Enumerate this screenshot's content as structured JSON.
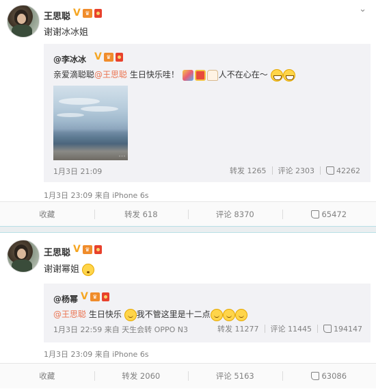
{
  "post1": {
    "author": "王思聪",
    "text": "谢谢冰冰姐",
    "repost": {
      "author": "@李冰冰",
      "text_before": "亲爱滴聪聪",
      "mention": "@王思聪",
      "text_middle": " 生日快乐哇！",
      "text_after": "人不在心在～",
      "time": "1月3日 21:09",
      "repost_count": "转发 1265",
      "comment_count": "评论 2303",
      "like_count": "42262"
    },
    "meta": "1月3日 23:09 来自 iPhone 6s",
    "actions": {
      "favorite": "收藏",
      "repost": "转发 618",
      "comment": "评论 8370",
      "like": "65472"
    }
  },
  "post2": {
    "author": "王思聪",
    "text": "谢谢幂姐",
    "repost": {
      "author": "@杨幂",
      "mention": "@王思聪",
      "text_middle": " 生日快乐",
      "text_after": "我不管这里是十二点",
      "time": "1月3日 22:59 来自 天生会转 OPPO N3",
      "repost_count": "转发 11277",
      "comment_count": "评论 11445",
      "like_count": "194147"
    },
    "meta": "1月3日 23:09 来自 iPhone 6s",
    "actions": {
      "favorite": "收藏",
      "repost": "转发 2060",
      "comment": "评论 5163",
      "like": "63086"
    }
  },
  "icons": {
    "verified": "V",
    "crown": "crown-icon",
    "red_packet": "red-packet-icon",
    "chevron": "chevron-down-icon"
  },
  "colors": {
    "mention": "#eb7350",
    "verified": "#f5a623",
    "separator": "#eaeef0"
  }
}
